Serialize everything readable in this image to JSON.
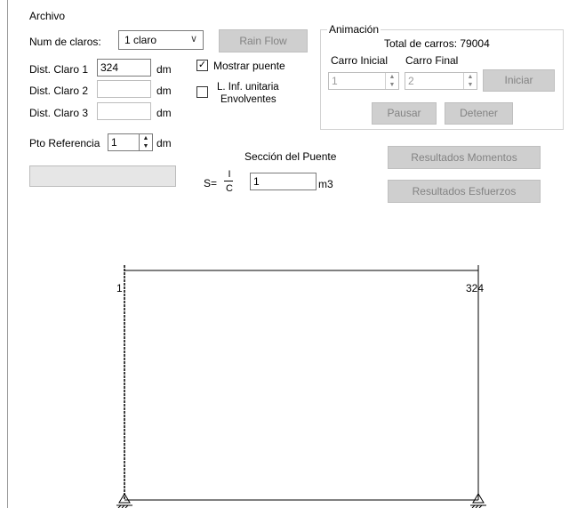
{
  "menu": {
    "archivo": "Archivo"
  },
  "claros": {
    "label": "Num de claros:",
    "selected": "1 claro",
    "dist1_label": "Dist. Claro 1",
    "dist1_value": "324",
    "dist2_label": "Dist. Claro 2",
    "dist2_value": "",
    "dist3_label": "Dist. Claro 3",
    "dist3_value": "",
    "unit": "dm"
  },
  "rainflow": {
    "label": "Rain Flow"
  },
  "options": {
    "mostrar_puente": "Mostrar puente",
    "mostrar_puente_checked": true,
    "linf_line1": "L. Inf. unitaria",
    "linf_line2": "Envolventes",
    "linf_checked": false
  },
  "animacion": {
    "legend": "Animación",
    "total_carros": "Total de carros: 79004",
    "carro_inicial_label": "Carro Inicial",
    "carro_final_label": "Carro Final",
    "carro_inicial_value": "1",
    "carro_final_value": "2",
    "iniciar": "Iniciar",
    "pausar": "Pausar",
    "detener": "Detener"
  },
  "referencia": {
    "label": "Pto Referencia",
    "value": "1",
    "unit": "dm"
  },
  "seccion": {
    "title": "Sección del Puente",
    "s_label": "S=",
    "frac_num": "I",
    "frac_den": "C",
    "value": "1",
    "unit": "m3"
  },
  "resultados": {
    "momentos": "Resultados Momentos",
    "esfuerzos": "Resultados Esfuerzos"
  },
  "diagram": {
    "left_label": "1",
    "right_label": "324"
  },
  "colors": {
    "disabled_button": "#cfcfcf",
    "border": "#7a7a7a",
    "line": "#000000"
  }
}
